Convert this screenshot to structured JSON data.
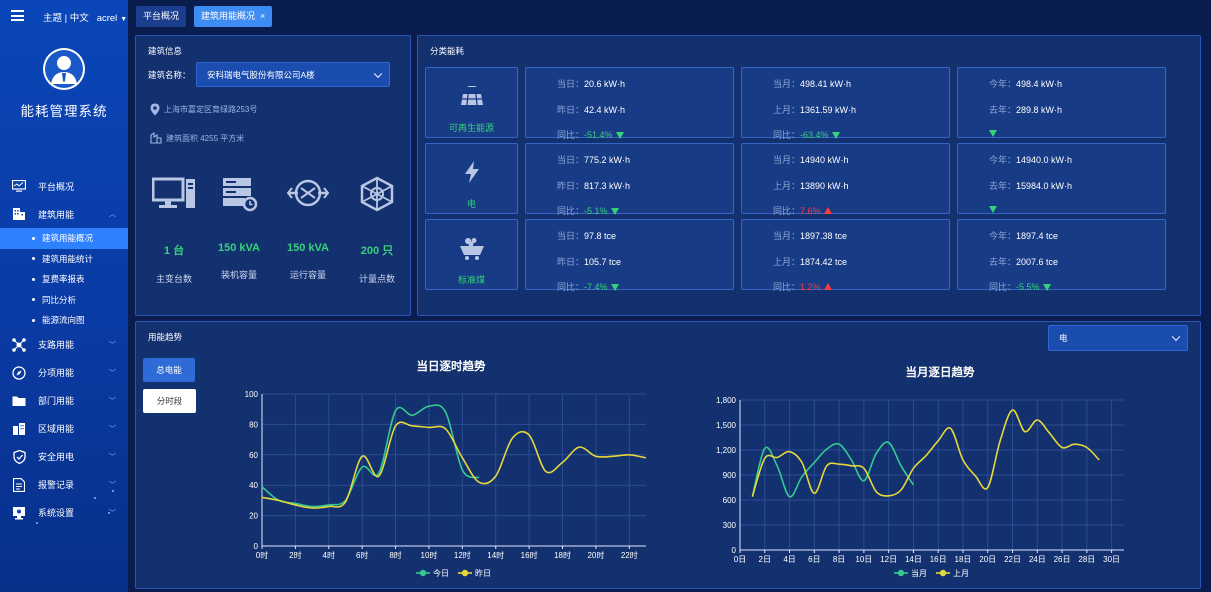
{
  "header": {
    "theme": "主题",
    "lang": "中文",
    "user": "acrel"
  },
  "sidebar": {
    "title": "能耗管理系统",
    "items": [
      {
        "label": "平台概况",
        "icon": "monitor-icon"
      },
      {
        "label": "建筑用能",
        "icon": "building-icon",
        "expanded": true
      },
      {
        "label": "支路用能",
        "icon": "branch-icon"
      },
      {
        "label": "分项用能",
        "icon": "compass-icon"
      },
      {
        "label": "部门用能",
        "icon": "folder-icon"
      },
      {
        "label": "区域用能",
        "icon": "region-icon"
      },
      {
        "label": "安全用电",
        "icon": "shield-icon"
      },
      {
        "label": "报警记录",
        "icon": "document-icon"
      },
      {
        "label": "系统设置",
        "icon": "settings-icon"
      }
    ],
    "subitems": [
      "建筑用能概况",
      "建筑用能统计",
      "复费率报表",
      "同比分析",
      "能源流向图"
    ]
  },
  "tabs": [
    {
      "label": "平台概况"
    },
    {
      "label": "建筑用能概况",
      "close": "×"
    }
  ],
  "building": {
    "panel_title": "建筑信息",
    "name_label": "建筑名称：",
    "name_value": "安科瑞电气股份有限公司A楼",
    "address": "上海市嘉定区育绿路253号",
    "area": "建筑面积 4255 平方米",
    "stats": [
      {
        "value": "1 台",
        "label": "主变台数",
        "icon": "computer-icon"
      },
      {
        "value": "150 kVA",
        "label": "装机容量",
        "icon": "server-icon"
      },
      {
        "value": "150 kVA",
        "label": "运行容量",
        "icon": "network-icon"
      },
      {
        "value": "200 只",
        "label": "计量点数",
        "icon": "hexagon-icon"
      }
    ]
  },
  "category": {
    "panel_title": "分类能耗",
    "rows": [
      {
        "name": "可再生能源",
        "icon": "solar-panel-icon",
        "day": {
          "cur_k": "当日：",
          "cur": "20.6 kW·h",
          "prev_k": "昨日：",
          "prev": "42.4 kW·h",
          "yoy_k": "同比：",
          "yoy": "-51.4%",
          "dir": "down"
        },
        "month": {
          "cur_k": "当月：",
          "cur": "498.41 kW·h",
          "prev_k": "上月：",
          "prev": "1361.59 kW·h",
          "yoy_k": "同比：",
          "yoy": "-63.4%",
          "dir": "down"
        },
        "year": {
          "cur_k": "今年：",
          "cur": "498.4 kW·h",
          "prev_k": "去年：",
          "prev": "289.8 kW·h",
          "yoy_k": "",
          "yoy": "",
          "dir": "down"
        }
      },
      {
        "name": "电",
        "icon": "lightning-icon",
        "day": {
          "cur_k": "当日：",
          "cur": "775.2 kW·h",
          "prev_k": "昨日：",
          "prev": "817.3 kW·h",
          "yoy_k": "同比：",
          "yoy": "-5.1%",
          "dir": "down"
        },
        "month": {
          "cur_k": "当月：",
          "cur": "14940 kW·h",
          "prev_k": "上月：",
          "prev": "13890 kW·h",
          "yoy_k": "同比：",
          "yoy": "7.6%",
          "dir": "up"
        },
        "year": {
          "cur_k": "今年：",
          "cur": "14940.0 kW·h",
          "prev_k": "去年：",
          "prev": "15984.0 kW·h",
          "yoy_k": "",
          "yoy": "",
          "dir": "down"
        }
      },
      {
        "name": "标准煤",
        "icon": "coal-cart-icon",
        "day": {
          "cur_k": "当日：",
          "cur": "97.8 tce",
          "prev_k": "昨日：",
          "prev": "105.7 tce",
          "yoy_k": "同比：",
          "yoy": "-7.4%",
          "dir": "down"
        },
        "month": {
          "cur_k": "当月：",
          "cur": "1897.38 tce",
          "prev_k": "上月：",
          "prev": "1874.42 tce",
          "yoy_k": "同比：",
          "yoy": "1.2%",
          "dir": "up"
        },
        "year": {
          "cur_k": "今年：",
          "cur": "1897.4 tce",
          "prev_k": "去年：",
          "prev": "2007.6 tce",
          "yoy_k": "同比：",
          "yoy": "-5.5%",
          "dir": "down"
        }
      }
    ]
  },
  "trend": {
    "panel_title": "用能趋势",
    "energy_select": "电",
    "btn_total": "总电能",
    "btn_period": "分时段"
  },
  "chart_data": [
    {
      "type": "line",
      "title": "当日逐时趋势",
      "x": [
        "0时",
        "1时",
        "2时",
        "3时",
        "4时",
        "5时",
        "6时",
        "7时",
        "8时",
        "9时",
        "10时",
        "11时",
        "12时",
        "13时",
        "14时",
        "15时",
        "16时",
        "17时",
        "18时",
        "19时",
        "20时",
        "21时",
        "22时",
        "23时"
      ],
      "xticks": [
        "0时",
        "2时",
        "4时",
        "6时",
        "8时",
        "10时",
        "12时",
        "14时",
        "16时",
        "18时",
        "20时",
        "22时"
      ],
      "ylim": [
        0,
        100
      ],
      "yticks": [
        0,
        20,
        40,
        60,
        80,
        100
      ],
      "series": [
        {
          "name": "今日",
          "color": "#35c98f",
          "values": [
            39,
            30,
            28,
            26,
            27,
            30,
            52,
            48,
            89,
            86,
            92,
            88,
            50,
            45
          ]
        },
        {
          "name": "昨日",
          "color": "#e6d83a",
          "values": [
            32,
            30,
            27,
            25,
            26,
            29,
            59,
            46,
            79,
            79,
            78,
            77,
            58,
            42,
            46,
            71,
            73,
            49,
            55,
            65,
            59,
            59,
            60,
            58
          ]
        }
      ],
      "legend": "bottom"
    },
    {
      "type": "line",
      "title": "当月逐日趋势",
      "x": [
        "0日",
        "1日",
        "2日",
        "3日",
        "4日",
        "5日",
        "6日",
        "7日",
        "8日",
        "9日",
        "10日",
        "11日",
        "12日",
        "13日",
        "14日",
        "15日",
        "16日",
        "17日",
        "18日",
        "19日",
        "20日",
        "21日",
        "22日",
        "23日",
        "24日",
        "25日",
        "26日",
        "27日",
        "28日",
        "29日",
        "30日",
        "31日"
      ],
      "xticks": [
        "0日",
        "2日",
        "4日",
        "6日",
        "8日",
        "10日",
        "12日",
        "14日",
        "16日",
        "18日",
        "20日",
        "22日",
        "24日",
        "26日",
        "28日",
        "30日"
      ],
      "ylim": [
        0,
        1800
      ],
      "yticks": [
        "0",
        "300",
        "600",
        "900",
        "1,200",
        "1,500",
        "1,800"
      ],
      "series": [
        {
          "name": "当月",
          "color": "#35c98f",
          "values": [
            null,
            640,
            1220,
            1010,
            640,
            880,
            1050,
            1210,
            1270,
            1080,
            830,
            1160,
            1290,
            1010,
            780
          ]
        },
        {
          "name": "上月",
          "color": "#e6d83a",
          "values": [
            null,
            640,
            1100,
            1110,
            1180,
            1050,
            680,
            1010,
            1030,
            1010,
            980,
            700,
            650,
            720,
            980,
            1130,
            1310,
            1460,
            1080,
            890,
            750,
            1310,
            1680,
            1420,
            1560,
            1400,
            1230,
            1270,
            1230,
            1080
          ]
        }
      ],
      "legend": "bottom"
    }
  ]
}
